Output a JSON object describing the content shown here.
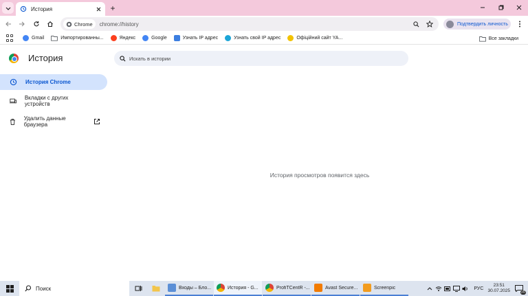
{
  "browser": {
    "tab_title": "История",
    "new_tab_symbol": "+",
    "omnibox": {
      "chip_label": "Chrome",
      "url": "chrome://history"
    },
    "profile_label": "Подтвердить личность",
    "bookmarks": [
      {
        "label": "Gmail",
        "icon": "google-g-icon",
        "color": "#4285f4"
      },
      {
        "label": "Импортированны...",
        "icon": "folder-icon",
        "color": "#5f6368"
      },
      {
        "label": "Яндекс",
        "icon": "yandex-icon",
        "color": "#fc3f1d"
      },
      {
        "label": "Google",
        "icon": "google-g-icon",
        "color": "#4285f4"
      },
      {
        "label": "Узнать IP адрес",
        "icon": "ip-icon",
        "color": "#3c7ee0"
      },
      {
        "label": "Узнать свой IP адрес",
        "icon": "w-icon",
        "color": "#1ca5d7"
      },
      {
        "label": "Офіційний сайт YA...",
        "icon": "star-badge-icon",
        "color": "#f2c200"
      }
    ],
    "all_bookmarks_label": "Все закладки"
  },
  "history_page": {
    "title": "История",
    "search_placeholder": "Искать в истории",
    "sidebar": [
      {
        "label": "История Chrome",
        "icon": "history-icon",
        "active": true
      },
      {
        "label": "Вкладки с других устройств",
        "icon": "devices-icon",
        "active": false
      },
      {
        "label": "Удалить данные браузера",
        "icon": "trash-icon",
        "active": false
      }
    ],
    "empty_message": "История просмотров появится здесь"
  },
  "taskbar": {
    "search_label": "Поиск",
    "apps": [
      {
        "label": "Входы – Бло...",
        "icon": "app-icon",
        "color": "#5b8fd6",
        "active": false
      },
      {
        "label": "История - G...",
        "icon": "chrome-icon",
        "color": "#db4437",
        "active": true
      },
      {
        "label": "ProfiTCentR -...",
        "icon": "chrome-icon",
        "color": "#db4437",
        "active": false
      },
      {
        "label": "Avast Secure...",
        "icon": "avast-icon",
        "color": "#f27b00",
        "active": false
      },
      {
        "label": "Screenpic",
        "icon": "screenpic-icon",
        "color": "#f29c1f",
        "active": false
      }
    ],
    "language": "РУС",
    "time": "23:51",
    "date": "30.07.2025",
    "notification_count": "20"
  }
}
